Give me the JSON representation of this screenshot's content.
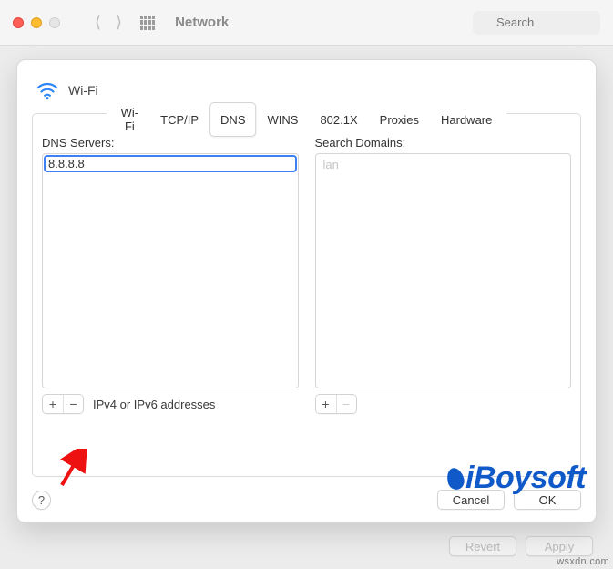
{
  "toolbar": {
    "title": "Network",
    "search_placeholder": "Search"
  },
  "sheet": {
    "connection_name": "Wi-Fi",
    "tabs": [
      "Wi-Fi",
      "TCP/IP",
      "DNS",
      "WINS",
      "802.1X",
      "Proxies",
      "Hardware"
    ],
    "active_tab": "DNS",
    "dns": {
      "servers_label": "DNS Servers:",
      "server_value": "8.8.8.8",
      "footer_hint": "IPv4 or IPv6 addresses"
    },
    "domains": {
      "label": "Search Domains:",
      "placeholder": "lan"
    },
    "buttons": {
      "help": "?",
      "cancel": "Cancel",
      "ok": "OK"
    }
  },
  "background_buttons": {
    "revert": "Revert",
    "apply": "Apply"
  },
  "overlays": {
    "logo": "iBoysoft",
    "source": "wsxdn.com"
  }
}
